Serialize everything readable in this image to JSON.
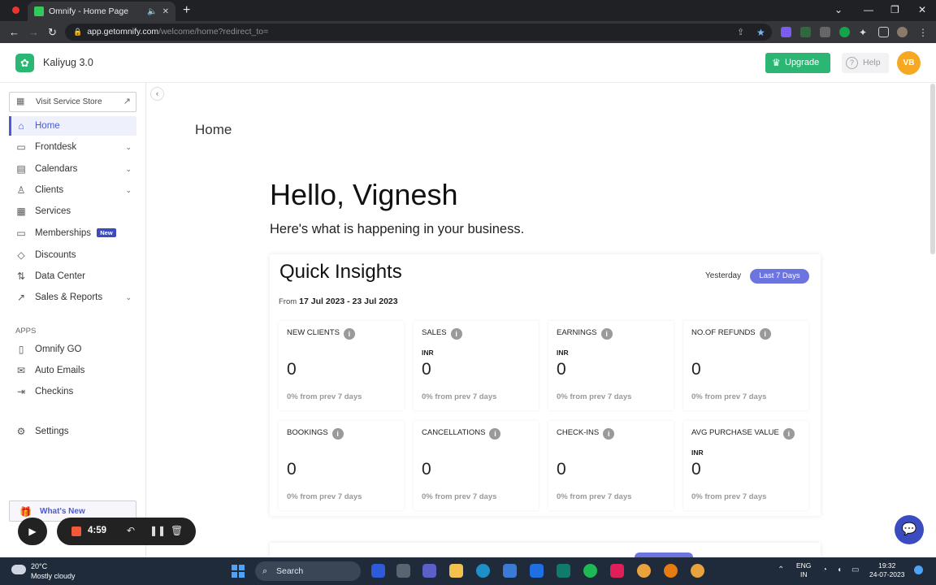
{
  "browser": {
    "tab_title": "Omnify - Home Page",
    "url_main": "app.getomnify.com",
    "url_rest": "/welcome/home?redirect_to="
  },
  "header": {
    "brand": "Kaliyug 3.0",
    "upgrade_label": "Upgrade",
    "help_label": "Help",
    "avatar_initials": "VB"
  },
  "sidebar": {
    "store_label": "Visit Service Store",
    "items": [
      {
        "label": "Home",
        "icon": "home-icon"
      },
      {
        "label": "Frontdesk",
        "icon": "monitor-icon"
      },
      {
        "label": "Calendars",
        "icon": "calendar-icon"
      },
      {
        "label": "Clients",
        "icon": "user-icon"
      },
      {
        "label": "Services",
        "icon": "grid-icon"
      },
      {
        "label": "Memberships",
        "icon": "card-icon",
        "badge": "New"
      },
      {
        "label": "Discounts",
        "icon": "tag-icon"
      },
      {
        "label": "Data Center",
        "icon": "transfer-icon"
      },
      {
        "label": "Sales & Reports",
        "icon": "chart-icon"
      }
    ],
    "apps_label": "APPS",
    "apps": [
      {
        "label": "Omnify GO",
        "icon": "go-icon"
      },
      {
        "label": "Auto Emails",
        "icon": "mail-icon"
      },
      {
        "label": "Checkins",
        "icon": "checkin-icon"
      }
    ],
    "settings_label": "Settings",
    "whats_new_label": "What's New"
  },
  "main": {
    "page_title": "Home",
    "greeting": "Hello, Vignesh",
    "subtitle": "Here's what is happening in your business.",
    "insights": {
      "title": "Quick Insights",
      "range_yesterday": "Yesterday",
      "range_last7": "Last 7 Days",
      "from_label": "From",
      "date_range": "17 Jul 2023 - 23 Jul 2023",
      "metrics": [
        {
          "label": "NEW CLIENTS",
          "currency": "",
          "value": "0",
          "change": "0% from prev 7 days"
        },
        {
          "label": "SALES",
          "currency": "INR",
          "value": "0",
          "change": "0% from prev 7 days"
        },
        {
          "label": "EARNINGS",
          "currency": "INR",
          "value": "0",
          "change": "0% from prev 7 days"
        },
        {
          "label": "NO.OF REFUNDS",
          "currency": "",
          "value": "0",
          "change": "0% from prev 7 days"
        },
        {
          "label": "BOOKINGS",
          "currency": "",
          "value": "0",
          "change": "0% from prev 7 days"
        },
        {
          "label": "CANCELLATIONS",
          "currency": "",
          "value": "0",
          "change": "0% from prev 7 days"
        },
        {
          "label": "CHECK-INS",
          "currency": "",
          "value": "0",
          "change": "0% from prev 7 days"
        },
        {
          "label": "AVG PURCHASE VALUE",
          "currency": "INR",
          "value": "0",
          "change": "0% from prev 7 days"
        }
      ]
    }
  },
  "recorder": {
    "time": "4:59"
  },
  "taskbar": {
    "temperature": "20°C",
    "weather": "Mostly cloudy",
    "search_label": "Search",
    "lang": "ENG",
    "region": "IN",
    "time": "19:32",
    "date": "24-07-2023"
  },
  "colors": {
    "accent": "#4c5bd4",
    "brand_green": "#2bb673",
    "pill": "#6c74e0"
  }
}
